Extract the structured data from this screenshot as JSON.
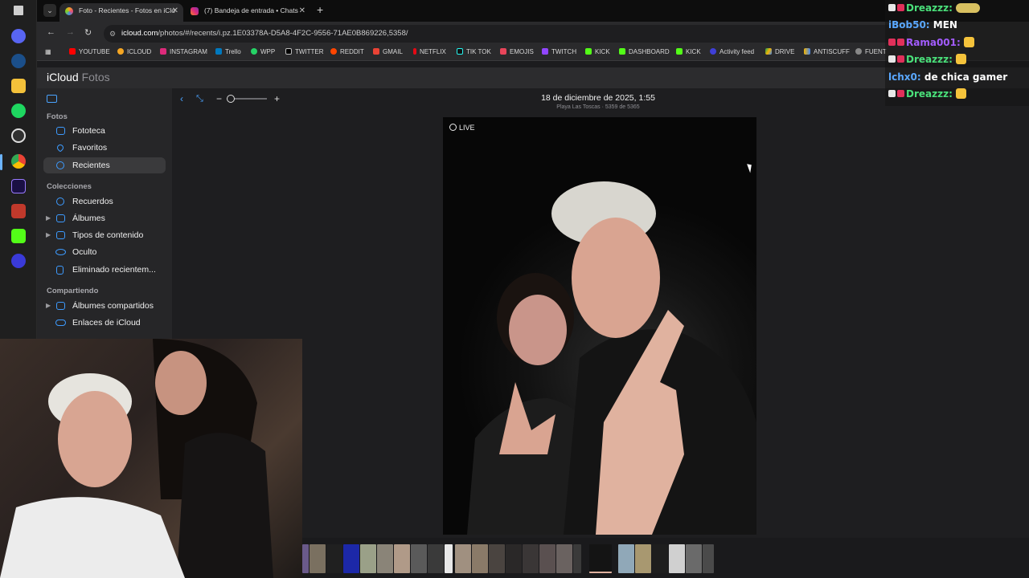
{
  "browser": {
    "tabs": [
      {
        "title": "Foto - Recientes - Fotos en iClo",
        "active": true
      },
      {
        "title": "(7) Bandeja de entrada • Chats",
        "active": false
      }
    ],
    "url_host": "icloud.com",
    "url_path": "/photos/#/recents/i.pz.1E03378A-D5A8-4F2C-9556-71AE0B869226,5358/",
    "bookmarks": [
      "YOUTUBE",
      "ICLOUD",
      "INSTAGRAM",
      "Trello",
      "WPP",
      "TWITTER",
      "REDDIT",
      "GMAIL",
      "NETFLIX",
      "TIK TOK",
      "EMOJIS",
      "TWITCH",
      "KICK",
      "DASHBOARD",
      "KICK",
      "Activity feed",
      "DRIVE",
      "ANTISCUFF",
      "FUENT"
    ]
  },
  "app": {
    "brand": "iCloud",
    "section": "Fotos"
  },
  "sidebar": {
    "fotos_heading": "Fotos",
    "fotos_items": [
      "Fototeca",
      "Favoritos",
      "Recientes"
    ],
    "colecciones_heading": "Colecciones",
    "colecciones_items": [
      "Recuerdos",
      "Álbumes",
      "Tipos de contenido",
      "Oculto",
      "Eliminado recientem..."
    ],
    "compartiendo_heading": "Compartiendo",
    "compartiendo_items": [
      "Álbumes compartidos",
      "Enlaces de iCloud"
    ]
  },
  "viewer": {
    "date_title": "18 de diciembre de 2025, 1:55",
    "subtitle": "Playa Las Toscas · 5359 de 5365",
    "live_label": "LIVE",
    "zoom_level": 0.0
  },
  "chat": {
    "messages": [
      {
        "user": "Dreazzz:",
        "text": "",
        "color": "#4ae07a"
      },
      {
        "user": "iBob50:",
        "text": "MEN",
        "color": "#5aa8ff"
      },
      {
        "user": "Rama001:",
        "text": "",
        "color": "#a35cff"
      },
      {
        "user": "Dreazzz:",
        "text": "",
        "color": "#4ae07a"
      },
      {
        "user": "lchx0:",
        "text": "de chica gamer",
        "color": "#5aa8ff"
      },
      {
        "user": "Dreazzz:",
        "text": "",
        "color": "#4ae07a"
      }
    ]
  },
  "colors": {
    "accent": "#3d9bff",
    "sidebar_bg": "#262628",
    "viewer_bg": "#1e1e20"
  }
}
